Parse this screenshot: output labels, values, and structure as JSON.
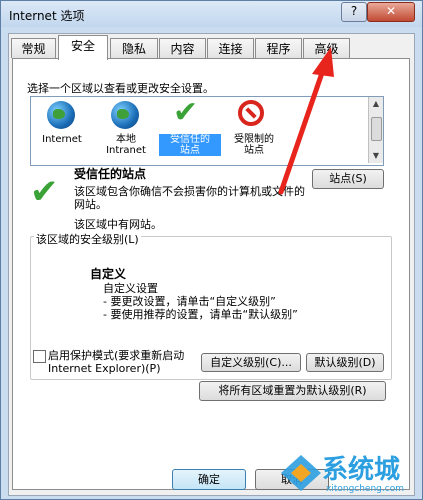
{
  "window": {
    "title": "Internet 选项",
    "help": "?",
    "close": "✕"
  },
  "tabs": [
    "常规",
    "安全",
    "隐私",
    "内容",
    "连接",
    "程序",
    "高级"
  ],
  "security": {
    "prompt": "选择一个区域以查看或更改安全设置。",
    "zones": [
      {
        "label": "Internet"
      },
      {
        "label": "本地\nIntranet"
      },
      {
        "label": "受信任的\n站点"
      },
      {
        "label": "受限制的\n站点"
      }
    ],
    "zone_title": "受信任的站点",
    "zone_desc": "该区域包含你确信不会损害你的计算机或文件的网站。",
    "no_sites": "该区域中有网站。",
    "sites_button": "站点(S)",
    "level_label": "该区域的安全级别(L)",
    "custom_title": "自定义",
    "custom_desc": "自定义设置\n- 要更改设置，请单击“自定义级别”\n- 要使用推荐的设置，请单击“默认级别”",
    "protected_mode": "启用保护模式(要求重新启动\nInternet Explorer)(P)",
    "custom_level_button": "自定义级别(C)...",
    "default_level_button": "默认级别(D)",
    "reset_all_button": "将所有区域重置为默认级别(R)"
  },
  "footer": {
    "ok": "确定",
    "cancel": "取消"
  },
  "watermark": {
    "brand": "系统城",
    "url": "xitongcheng.com"
  },
  "colors": {
    "accent": "#3399ff",
    "arrow": "#e8251c",
    "check": "#3aa236",
    "watermark": "#2c9fe0"
  }
}
